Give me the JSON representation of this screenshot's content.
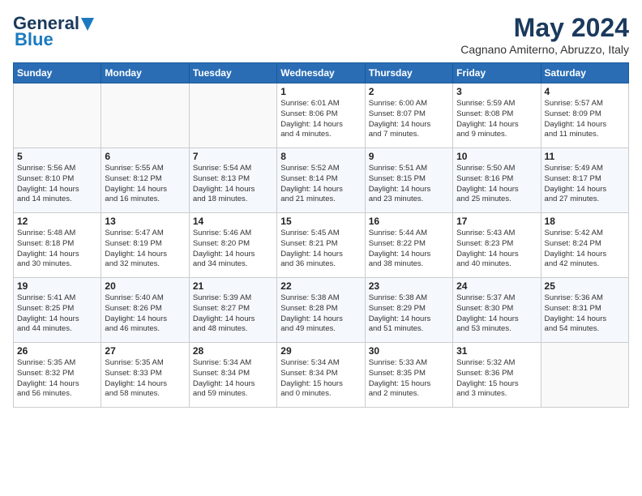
{
  "header": {
    "logo_general": "General",
    "logo_blue": "Blue",
    "month_year": "May 2024",
    "location": "Cagnano Amiterno, Abruzzo, Italy"
  },
  "weekdays": [
    "Sunday",
    "Monday",
    "Tuesday",
    "Wednesday",
    "Thursday",
    "Friday",
    "Saturday"
  ],
  "weeks": [
    [
      {
        "day": "",
        "info": ""
      },
      {
        "day": "",
        "info": ""
      },
      {
        "day": "",
        "info": ""
      },
      {
        "day": "1",
        "info": "Sunrise: 6:01 AM\nSunset: 8:06 PM\nDaylight: 14 hours\nand 4 minutes."
      },
      {
        "day": "2",
        "info": "Sunrise: 6:00 AM\nSunset: 8:07 PM\nDaylight: 14 hours\nand 7 minutes."
      },
      {
        "day": "3",
        "info": "Sunrise: 5:59 AM\nSunset: 8:08 PM\nDaylight: 14 hours\nand 9 minutes."
      },
      {
        "day": "4",
        "info": "Sunrise: 5:57 AM\nSunset: 8:09 PM\nDaylight: 14 hours\nand 11 minutes."
      }
    ],
    [
      {
        "day": "5",
        "info": "Sunrise: 5:56 AM\nSunset: 8:10 PM\nDaylight: 14 hours\nand 14 minutes."
      },
      {
        "day": "6",
        "info": "Sunrise: 5:55 AM\nSunset: 8:12 PM\nDaylight: 14 hours\nand 16 minutes."
      },
      {
        "day": "7",
        "info": "Sunrise: 5:54 AM\nSunset: 8:13 PM\nDaylight: 14 hours\nand 18 minutes."
      },
      {
        "day": "8",
        "info": "Sunrise: 5:52 AM\nSunset: 8:14 PM\nDaylight: 14 hours\nand 21 minutes."
      },
      {
        "day": "9",
        "info": "Sunrise: 5:51 AM\nSunset: 8:15 PM\nDaylight: 14 hours\nand 23 minutes."
      },
      {
        "day": "10",
        "info": "Sunrise: 5:50 AM\nSunset: 8:16 PM\nDaylight: 14 hours\nand 25 minutes."
      },
      {
        "day": "11",
        "info": "Sunrise: 5:49 AM\nSunset: 8:17 PM\nDaylight: 14 hours\nand 27 minutes."
      }
    ],
    [
      {
        "day": "12",
        "info": "Sunrise: 5:48 AM\nSunset: 8:18 PM\nDaylight: 14 hours\nand 30 minutes."
      },
      {
        "day": "13",
        "info": "Sunrise: 5:47 AM\nSunset: 8:19 PM\nDaylight: 14 hours\nand 32 minutes."
      },
      {
        "day": "14",
        "info": "Sunrise: 5:46 AM\nSunset: 8:20 PM\nDaylight: 14 hours\nand 34 minutes."
      },
      {
        "day": "15",
        "info": "Sunrise: 5:45 AM\nSunset: 8:21 PM\nDaylight: 14 hours\nand 36 minutes."
      },
      {
        "day": "16",
        "info": "Sunrise: 5:44 AM\nSunset: 8:22 PM\nDaylight: 14 hours\nand 38 minutes."
      },
      {
        "day": "17",
        "info": "Sunrise: 5:43 AM\nSunset: 8:23 PM\nDaylight: 14 hours\nand 40 minutes."
      },
      {
        "day": "18",
        "info": "Sunrise: 5:42 AM\nSunset: 8:24 PM\nDaylight: 14 hours\nand 42 minutes."
      }
    ],
    [
      {
        "day": "19",
        "info": "Sunrise: 5:41 AM\nSunset: 8:25 PM\nDaylight: 14 hours\nand 44 minutes."
      },
      {
        "day": "20",
        "info": "Sunrise: 5:40 AM\nSunset: 8:26 PM\nDaylight: 14 hours\nand 46 minutes."
      },
      {
        "day": "21",
        "info": "Sunrise: 5:39 AM\nSunset: 8:27 PM\nDaylight: 14 hours\nand 48 minutes."
      },
      {
        "day": "22",
        "info": "Sunrise: 5:38 AM\nSunset: 8:28 PM\nDaylight: 14 hours\nand 49 minutes."
      },
      {
        "day": "23",
        "info": "Sunrise: 5:38 AM\nSunset: 8:29 PM\nDaylight: 14 hours\nand 51 minutes."
      },
      {
        "day": "24",
        "info": "Sunrise: 5:37 AM\nSunset: 8:30 PM\nDaylight: 14 hours\nand 53 minutes."
      },
      {
        "day": "25",
        "info": "Sunrise: 5:36 AM\nSunset: 8:31 PM\nDaylight: 14 hours\nand 54 minutes."
      }
    ],
    [
      {
        "day": "26",
        "info": "Sunrise: 5:35 AM\nSunset: 8:32 PM\nDaylight: 14 hours\nand 56 minutes."
      },
      {
        "day": "27",
        "info": "Sunrise: 5:35 AM\nSunset: 8:33 PM\nDaylight: 14 hours\nand 58 minutes."
      },
      {
        "day": "28",
        "info": "Sunrise: 5:34 AM\nSunset: 8:34 PM\nDaylight: 14 hours\nand 59 minutes."
      },
      {
        "day": "29",
        "info": "Sunrise: 5:34 AM\nSunset: 8:34 PM\nDaylight: 15 hours\nand 0 minutes."
      },
      {
        "day": "30",
        "info": "Sunrise: 5:33 AM\nSunset: 8:35 PM\nDaylight: 15 hours\nand 2 minutes."
      },
      {
        "day": "31",
        "info": "Sunrise: 5:32 AM\nSunset: 8:36 PM\nDaylight: 15 hours\nand 3 minutes."
      },
      {
        "day": "",
        "info": ""
      }
    ]
  ]
}
